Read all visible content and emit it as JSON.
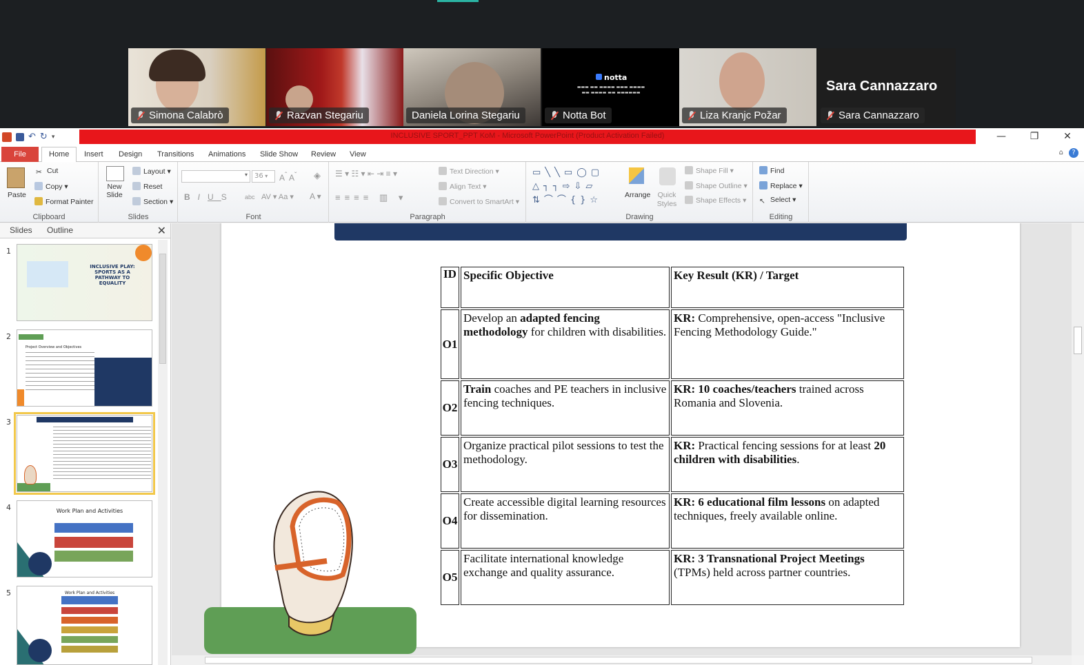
{
  "meeting": {
    "participants": [
      {
        "name": "Simona Calabrò",
        "muted": true
      },
      {
        "name": "Razvan Stegariu",
        "muted": true
      },
      {
        "name": "Daniela Lorina Stegariu",
        "muted": false,
        "speaking": true
      },
      {
        "name": "Notta Bot",
        "muted": true
      },
      {
        "name": "Liza Kranjc Požar",
        "muted": true
      },
      {
        "name": "Sara Cannazzaro",
        "muted": true
      }
    ],
    "notta_logo": "notta",
    "sara_display_name": "Sara Cannazzaro"
  },
  "window": {
    "title": "INCLUSIVE SPORT_PPT KoM  -  Microsoft PowerPoint (Product Activation Failed)",
    "minimize": "—",
    "restore": "❐",
    "close": "✕"
  },
  "ribbon_tabs": [
    "File",
    "Home",
    "Insert",
    "Design",
    "Transitions",
    "Animations",
    "Slide Show",
    "Review",
    "View"
  ],
  "ribbon": {
    "clipboard": {
      "label": "Clipboard",
      "paste": "Paste",
      "cut": "Cut",
      "copy": "Copy",
      "format_painter": "Format Painter"
    },
    "slides": {
      "label": "Slides",
      "new_slide": "New Slide",
      "layout": "Layout",
      "reset": "Reset",
      "section": "Section"
    },
    "font": {
      "label": "Font",
      "size": "36"
    },
    "paragraph": {
      "label": "Paragraph",
      "text_direction": "Text Direction",
      "align_text": "Align Text",
      "convert": "Convert to SmartArt"
    },
    "drawing": {
      "label": "Drawing",
      "arrange": "Arrange",
      "quick_styles": "Quick Styles",
      "shape_fill": "Shape Fill",
      "shape_outline": "Shape Outline",
      "shape_effects": "Shape Effects"
    },
    "editing": {
      "label": "Editing",
      "find": "Find",
      "replace": "Replace",
      "select": "Select"
    }
  },
  "slides_pane": {
    "tabs": [
      "Slides",
      "Outline"
    ],
    "thumbnails": [
      {
        "num": "1",
        "title": "INCLUSIVE PLAY: SPORTS AS A PATHWAY TO EQUALITY"
      },
      {
        "num": "2",
        "title": "Project Overview and Objectives"
      },
      {
        "num": "3",
        "title": ""
      },
      {
        "num": "4",
        "title": "Work Plan and Activities"
      },
      {
        "num": "5",
        "title": "Work Plan and Activities"
      }
    ],
    "selected": 3
  },
  "slide_table": {
    "headers": {
      "id": "ID",
      "objective": "Specific Objective",
      "kr": "Key Result (KR) / Target"
    },
    "rows": [
      {
        "id": "O1",
        "obj": [
          {
            "t": "Develop an ",
            "b": false
          },
          {
            "t": "adapted fencing methodology",
            "b": true
          },
          {
            "t": " for children with disabilities.",
            "b": false
          }
        ],
        "kr": [
          {
            "t": "KR:",
            "b": true
          },
          {
            "t": " Comprehensive, open-access \"Inclusive Fencing Methodology Guide.\"",
            "b": false
          }
        ]
      },
      {
        "id": "O2",
        "obj": [
          {
            "t": "Train",
            "b": true
          },
          {
            "t": " coaches and PE teachers in inclusive fencing techniques.",
            "b": false
          }
        ],
        "kr": [
          {
            "t": "KR: 10 coaches/teachers",
            "b": true
          },
          {
            "t": " trained across Romania and Slovenia.",
            "b": false
          }
        ]
      },
      {
        "id": "O3",
        "obj": [
          {
            "t": "Organize practical pilot sessions to test the methodology.",
            "b": false
          }
        ],
        "kr": [
          {
            "t": "KR:",
            "b": true
          },
          {
            "t": " Practical fencing sessions for at least ",
            "b": false
          },
          {
            "t": "20 children with disabilities",
            "b": true
          },
          {
            "t": ".",
            "b": false
          }
        ]
      },
      {
        "id": "O4",
        "obj": [
          {
            "t": "Create accessible digital learning resources for dissemination.",
            "b": false
          }
        ],
        "kr": [
          {
            "t": "KR: 6 educational film lessons",
            "b": true
          },
          {
            "t": " on adapted techniques, freely available online.",
            "b": false
          }
        ]
      },
      {
        "id": "O5",
        "obj": [
          {
            "t": "Facilitate international knowledge exchange and quality assurance.",
            "b": false
          }
        ],
        "kr": [
          {
            "t": "KR: 3 Transnational Project Meetings",
            "b": true
          },
          {
            "t": " (TPMs) held across partner countries.",
            "b": false
          }
        ]
      }
    ]
  },
  "colors": {
    "accent_red": "#e8161b",
    "file_tab": "#d9443b",
    "slide_header": "#1f3864",
    "speaker_outline": "#2dd47a",
    "green_block": "#5f9e55"
  }
}
